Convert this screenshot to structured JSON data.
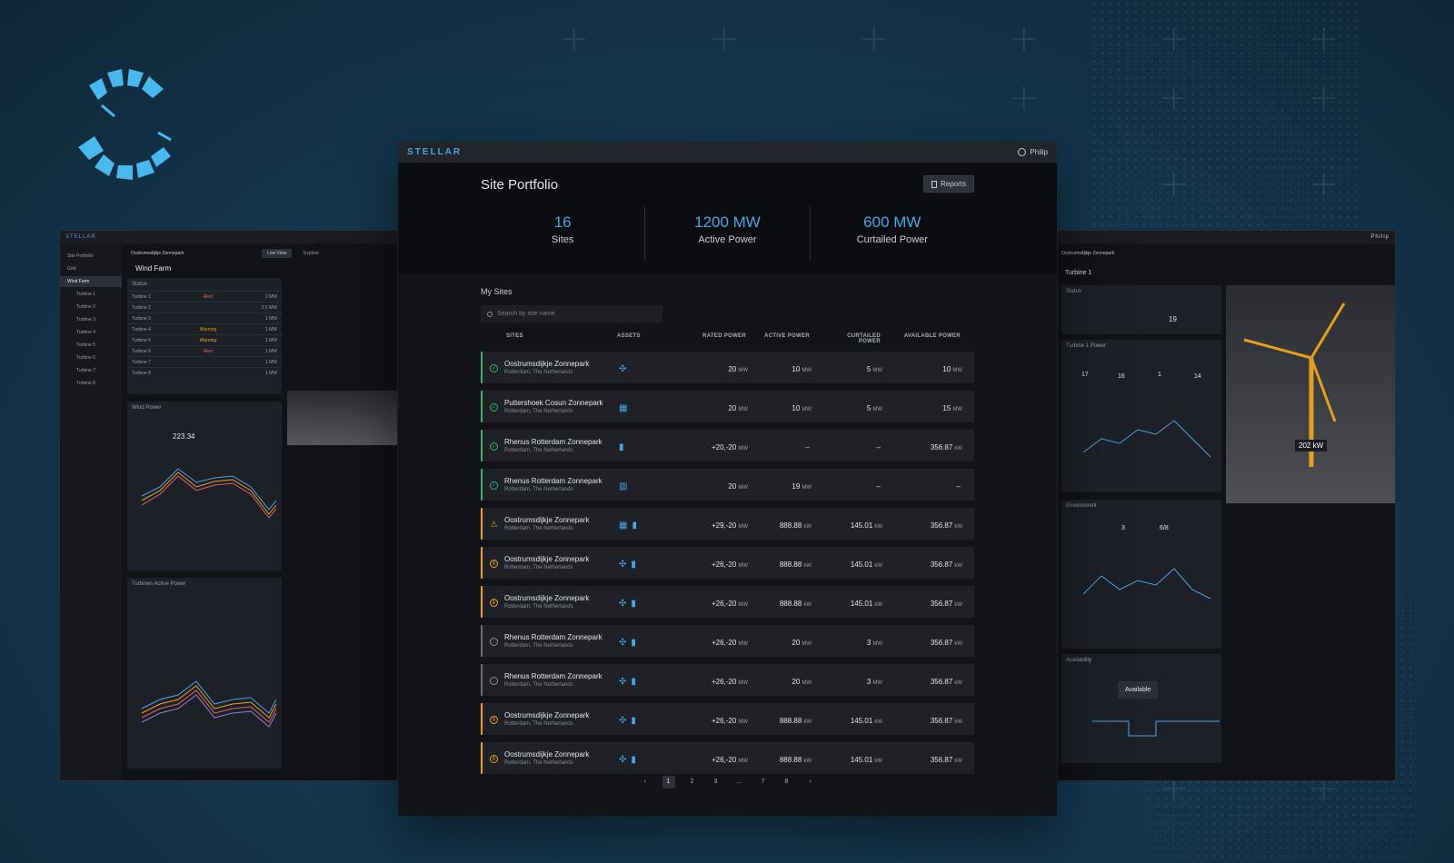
{
  "brand": "STELLAR",
  "user": "Philip",
  "page_title": "Site Portfolio",
  "reports_label": "Reports",
  "kpis": [
    {
      "value": "16",
      "label": "Sites"
    },
    {
      "value": "1200 MW",
      "label": "Active Power"
    },
    {
      "value": "600 MW",
      "label": "Curtailed Power"
    }
  ],
  "my_sites_title": "My Sites",
  "search_placeholder": "Search by site name",
  "columns": [
    "SITES",
    "ASSETS",
    "RATED POWER",
    "ACTIVE POWER",
    "CURTAILED POWER",
    "AVAILABLE POWER"
  ],
  "rows": [
    {
      "status": "ok",
      "name": "Oostrumsdijkje Zonnepark",
      "loc": "Rotterdam, The Netherlands",
      "assets": [
        "turbine"
      ],
      "rated": "20",
      "rated_u": "MW",
      "active": "10",
      "active_u": "MW",
      "curt": "5",
      "curt_u": "MW",
      "avail": "10",
      "avail_u": "MW"
    },
    {
      "status": "ok",
      "name": "Puttershoek Cosun Zonnepark",
      "loc": "Rotterdam, The Netherlands",
      "assets": [
        "solar"
      ],
      "rated": "20",
      "rated_u": "MW",
      "active": "10",
      "active_u": "MW",
      "curt": "5",
      "curt_u": "MW",
      "avail": "15",
      "avail_u": "MW"
    },
    {
      "status": "ok",
      "name": "Rhenus Rotterdam Zonnepark",
      "loc": "Rotterdam, The Netherlands",
      "assets": [
        "battery"
      ],
      "rated": "+20,-20",
      "rated_u": "MW",
      "active": "–",
      "active_u": "",
      "curt": "–",
      "curt_u": "",
      "avail": "356.87",
      "avail_u": "kW"
    },
    {
      "status": "ok",
      "name": "Rhenus Rotterdam Zonnepark",
      "loc": "Rotterdam, The Netherlands",
      "assets": [
        "grid"
      ],
      "rated": "20",
      "rated_u": "MW",
      "active": "19",
      "active_u": "MW",
      "curt": "–",
      "curt_u": "",
      "avail": "–",
      "avail_u": ""
    },
    {
      "status": "warn",
      "name": "Oostrumsdijkje Zonnepark",
      "loc": "Rotterdam, The Netherlands",
      "assets": [
        "solar",
        "battery"
      ],
      "rated": "+29,-20",
      "rated_u": "MW",
      "active": "888.88",
      "active_u": "kW",
      "curt": "145.01",
      "curt_u": "kW",
      "avail": "356.87",
      "avail_u": "kW"
    },
    {
      "status": "pause",
      "name": "Oostrumsdijkje Zonnepark",
      "loc": "Rotterdam, The Netherlands",
      "assets": [
        "turbine",
        "battery"
      ],
      "rated": "+26,-20",
      "rated_u": "MW",
      "active": "888.88",
      "active_u": "kW",
      "curt": "145.01",
      "curt_u": "kW",
      "avail": "356.87",
      "avail_u": "kW"
    },
    {
      "status": "pause",
      "name": "Oostrumsdijkje Zonnepark",
      "loc": "Rotterdam, The Netherlands",
      "assets": [
        "turbine",
        "battery"
      ],
      "rated": "+26,-20",
      "rated_u": "MW",
      "active": "888.88",
      "active_u": "kW",
      "curt": "145.01",
      "curt_u": "kW",
      "avail": "356.87",
      "avail_u": "kW"
    },
    {
      "status": "off",
      "name": "Rhenus Rotterdam Zonnepark",
      "loc": "Rotterdam, The Netherlands",
      "assets": [
        "turbine",
        "battery"
      ],
      "rated": "+26,-20",
      "rated_u": "MW",
      "active": "20",
      "active_u": "MW",
      "curt": "3",
      "curt_u": "MW",
      "avail": "356.87",
      "avail_u": "kW"
    },
    {
      "status": "off",
      "name": "Rhenus Rotterdam Zonnepark",
      "loc": "Rotterdam, The Netherlands",
      "assets": [
        "turbine",
        "battery"
      ],
      "rated": "+26,-20",
      "rated_u": "MW",
      "active": "20",
      "active_u": "MW",
      "curt": "3",
      "curt_u": "MW",
      "avail": "356.87",
      "avail_u": "kW"
    },
    {
      "status": "pause",
      "name": "Oostrumsdijkje Zonnepark",
      "loc": "Rotterdam, The Netherlands",
      "assets": [
        "turbine",
        "battery"
      ],
      "rated": "+26,-20",
      "rated_u": "MW",
      "active": "888.88",
      "active_u": "kW",
      "curt": "145.01",
      "curt_u": "kW",
      "avail": "356.87",
      "avail_u": "kW"
    },
    {
      "status": "pause",
      "name": "Oostrumsdijkje Zonnepark",
      "loc": "Rotterdam, The Netherlands",
      "assets": [
        "turbine",
        "battery"
      ],
      "rated": "+26,-20",
      "rated_u": "MW",
      "active": "888.88",
      "active_u": "kW",
      "curt": "145.01",
      "curt_u": "kW",
      "avail": "356.87",
      "avail_u": "kW"
    }
  ],
  "pagination": [
    "1",
    "2",
    "3",
    "...",
    "7",
    "8"
  ],
  "pagination_active": "1",
  "left_window": {
    "brand": "STELLAR",
    "site": "Oostrumsdijkje Zonnepark",
    "live_view": "Live View",
    "explore": "Explore",
    "title": "Wind Farm",
    "nav": [
      "Site Portfolio",
      "Grid",
      "Wind Farm",
      "Turbine 1",
      "Turbine 2",
      "Turbine 3",
      "Turbine 4",
      "Turbine 5",
      "Turbine 6",
      "Turbine 7",
      "Turbine 8"
    ],
    "status_title": "Status",
    "status_rows": [
      [
        "Turbine 1",
        "Alert",
        "2 MW"
      ],
      [
        "Turbine 2",
        "",
        "2.5 MW"
      ],
      [
        "Turbine 3",
        "",
        "1 MW"
      ],
      [
        "Turbine 4",
        "Warning",
        "1 MW"
      ],
      [
        "Turbine 5",
        "Warning",
        "1 MW"
      ],
      [
        "Turbine 6",
        "Alert",
        "1 MW"
      ],
      [
        "Turbine 7",
        "",
        "1 MW"
      ],
      [
        "Turbine 8",
        "",
        "1 MW"
      ]
    ],
    "wind_power_title": "Wind Power",
    "wind_power_value": "223.34",
    "turbines_active_power": "Turbines Active Power"
  },
  "right_window": {
    "user": "Philip",
    "site": "Oostrumsdijkje Zonnepark",
    "title": "Turbine 1",
    "status_title": "Status",
    "active_power": "19",
    "turbine_power_title": "Turbine 1 Power",
    "setpoint": "17",
    "active": "16",
    "available_up": "1",
    "available_down": "14",
    "environment_title": "Environment",
    "wind_speed": "3",
    "turbine_active": "6/8",
    "availability_title": "Availability",
    "availability_value": "Available",
    "turbine_kw": "202 kW"
  },
  "colors": {
    "accent": "#49a8e3",
    "ok": "#3cb371",
    "warn": "#f0a020"
  }
}
